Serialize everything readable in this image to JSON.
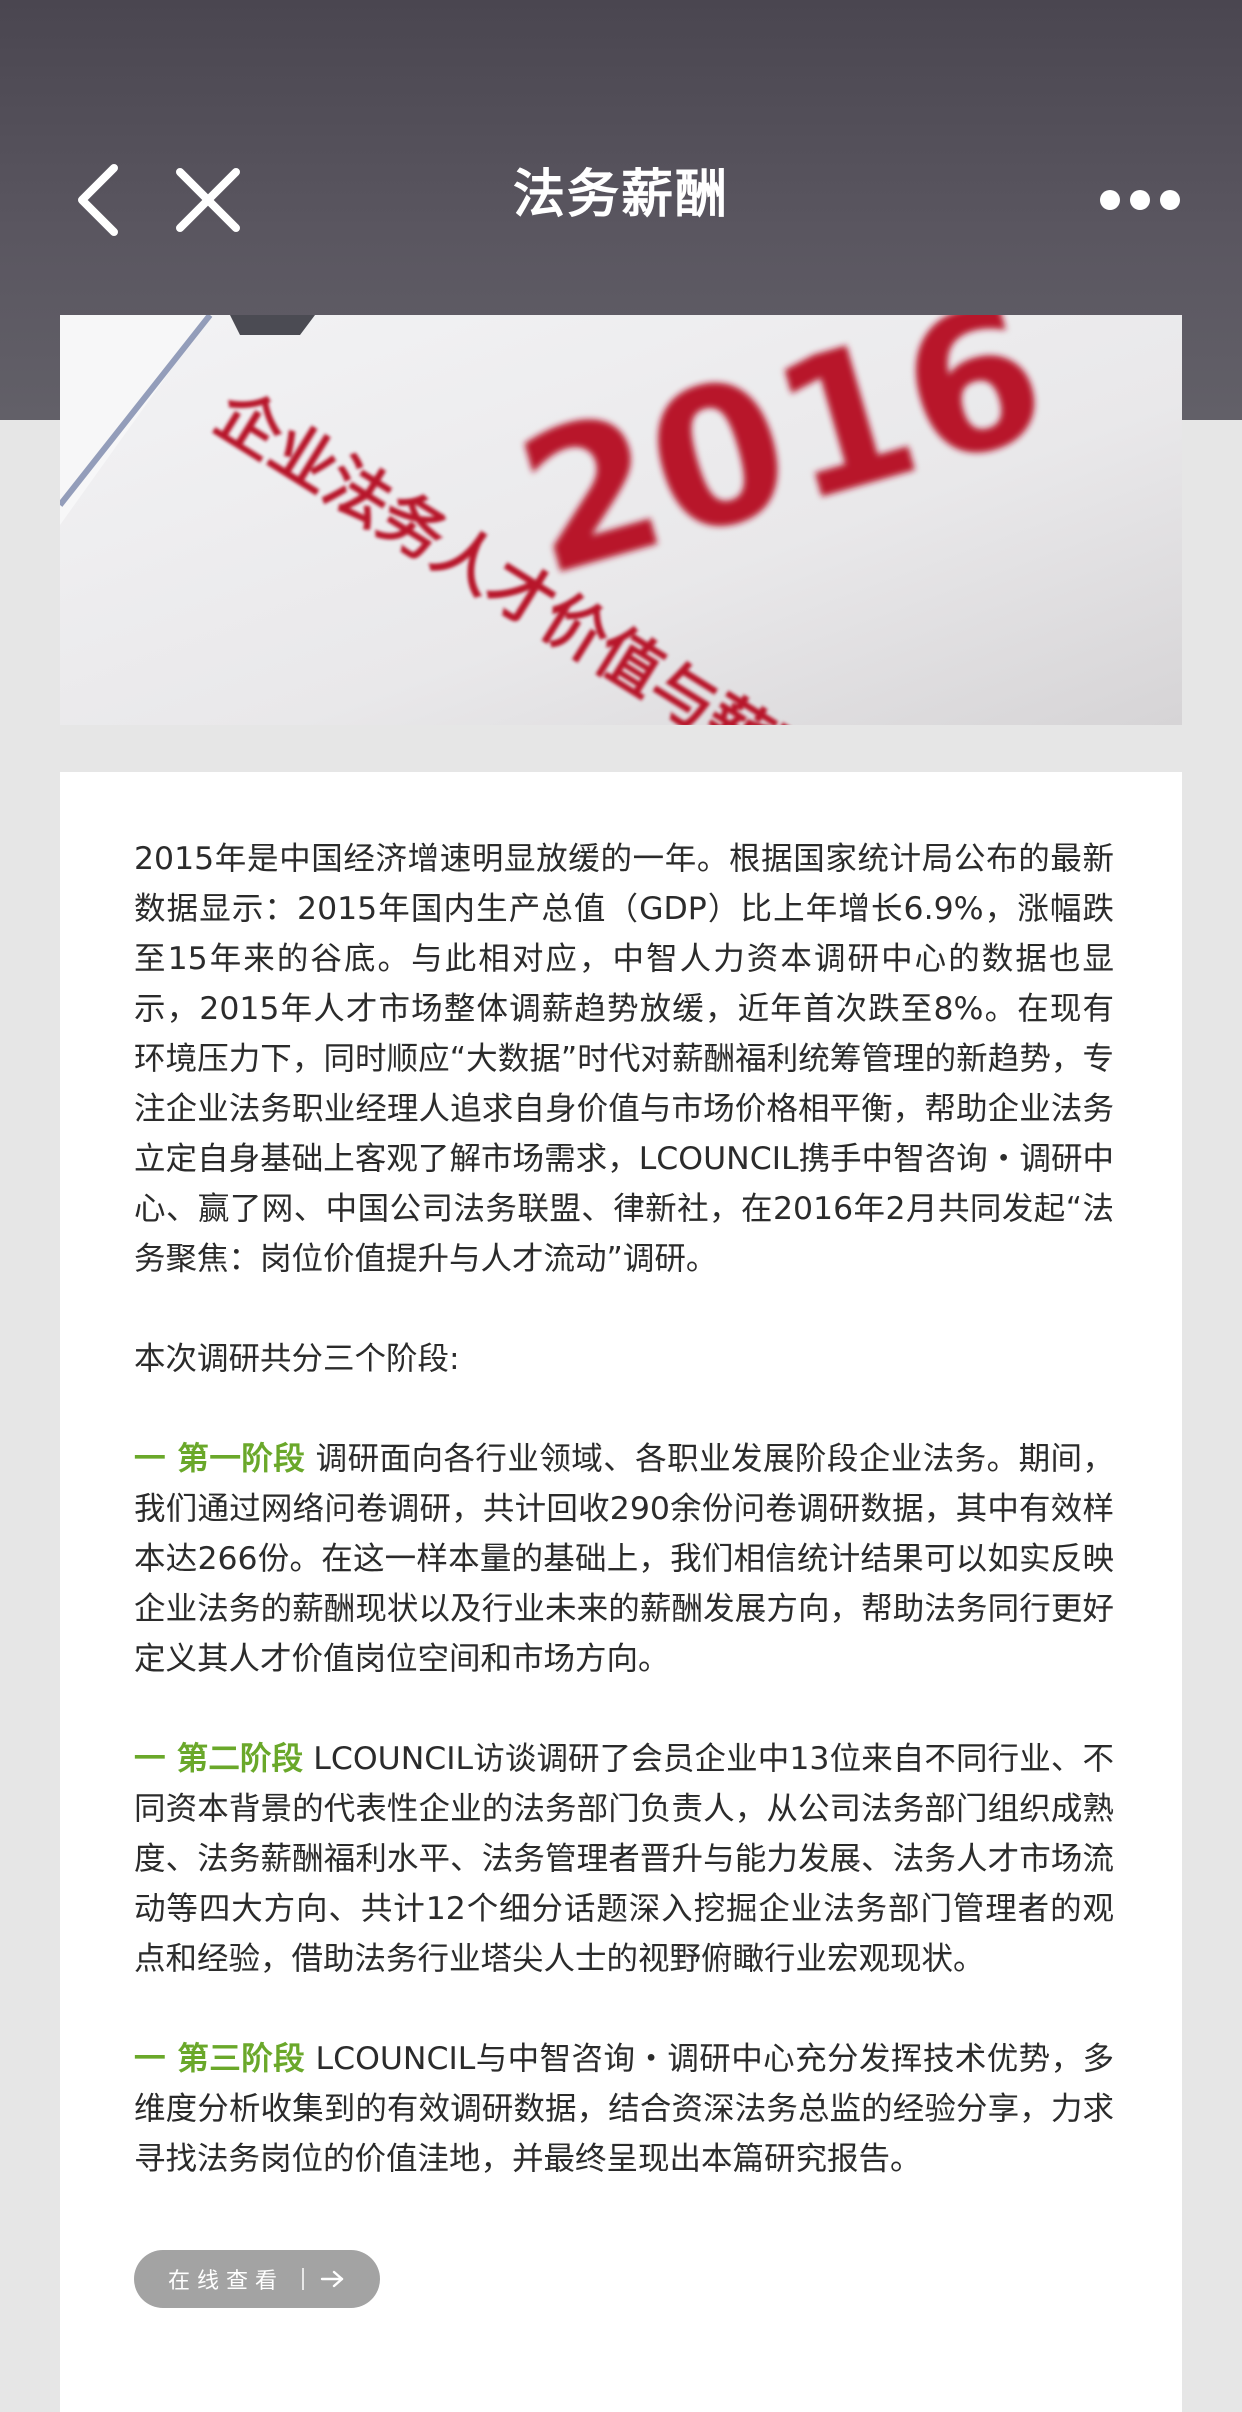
{
  "nav": {
    "title": "法务薪酬",
    "back_icon": "chevron-left-icon",
    "close_icon": "close-icon",
    "more_icon": "more-dots-icon"
  },
  "banner": {
    "year_text": "2016",
    "report_title_text": "企业法务人才价值与薪酬福利报告"
  },
  "article": {
    "para1": "2015年是中国经济增速明显放缓的一年。根据国家统计局公布的最新数据显示：2015年国内生产总值（GDP）比上年增长6.9%，涨幅跌至15年来的谷底。与此相对应，中智人力资本调研中心的数据也显示，2015年人才市场整体调薪趋势放缓，近年首次跌至8%。在现有环境压力下，同时顺应“大数据”时代对薪酬福利统筹管理的新趋势，专注企业法务职业经理人追求自身价值与市场价格相平衡，帮助企业法务立定自身基础上客观了解市场需求，LCOUNCIL携手中智咨询・调研中心、赢了网、中国公司法务联盟、律新社，在2016年2月共同发起“法务聚焦：岗位价值提升与人才流动”调研。",
    "para2": "本次调研共分三个阶段:",
    "stage1_label": "一 第一阶段",
    "stage1_text": " 调研面向各行业领域、各职业发展阶段企业法务。期间，我们通过网络问卷调研，共计回收290余份问卷调研数据，其中有效样本达266份。在这一样本量的基础上，我们相信统计结果可以如实反映企业法务的薪酬现状以及行业未来的薪酬发展方向，帮助法务同行更好定义其人才价值岗位空间和市场方向。",
    "stage2_label": "一 第二阶段",
    "stage2_text": " LCOUNCIL访谈调研了会员企业中13位来自不同行业、不同资本背景的代表性企业的法务部门负责人，从公司法务部门组织成熟度、法务薪酬福利水平、法务管理者晋升与能力发展、法务人才市场流动等四大方向、共计12个细分话题深入挖掘企业法务部门管理者的观点和经验，借助法务行业塔尖人士的视野俯瞰行业宏观现状。",
    "stage3_label": "一 第三阶段",
    "stage3_text": " LCOUNCIL与中智咨询・调研中心充分发挥技术优势，多维度分析收集到的有效调研数据，结合资深法务总监的经验分享，力求寻找法务岗位的价值洼地，并最终呈现出本篇研究报告。"
  },
  "view_button": {
    "label": "在线查看",
    "icon": "arrow-right-icon"
  },
  "colors": {
    "header": "#55515b",
    "accent_green": "#6aa82a",
    "banner_red": "#b8142a",
    "button_gray": "#a3a3a3"
  }
}
